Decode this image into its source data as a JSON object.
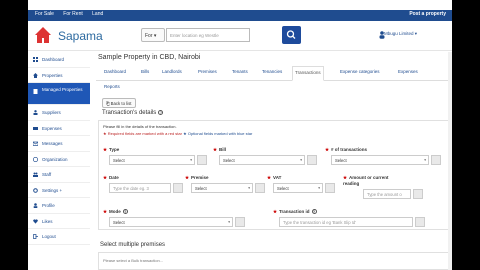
{
  "topnav": {
    "links": [
      "For Sale",
      "For Rent",
      "Land"
    ],
    "post_label": "Post a property"
  },
  "header": {
    "logo_text": "Sapama",
    "for_label": "For",
    "search_placeholder": "Enter location eg Westle",
    "user_label": "Mbugu Limited"
  },
  "sidebar": {
    "items": [
      {
        "label": "Dashboard",
        "icon": "dashboard-icon"
      },
      {
        "label": "Properties",
        "icon": "home-icon"
      },
      {
        "label": "Managed Properties",
        "icon": "building-icon"
      },
      {
        "label": "Suppliers",
        "icon": "user-icon"
      },
      {
        "label": "Expenses",
        "icon": "money-icon"
      },
      {
        "label": "Messages",
        "icon": "envelope-icon"
      },
      {
        "label": "Organization",
        "icon": "org-icon"
      },
      {
        "label": "Staff",
        "icon": "users-icon"
      },
      {
        "label": "Settings +",
        "icon": "gear-icon"
      },
      {
        "label": "Profile",
        "icon": "profile-icon"
      },
      {
        "label": "Likes",
        "icon": "heart-icon"
      },
      {
        "label": "Logout",
        "icon": "logout-icon"
      }
    ]
  },
  "main": {
    "title": "Sample Property in CBD, Nairobi",
    "tabs": [
      "Dashboard",
      "Bills",
      "Landlords",
      "Premises",
      "Tenants",
      "Tenancies",
      "Transactions",
      "Expense categories",
      "Expenses"
    ],
    "reports_label": "Reports",
    "back_label": "Back to list",
    "section_title": "Transaction's details",
    "instruction": "Please fill in the details of the transaction.",
    "required_note": "Required fields are marked with a red star",
    "optional_note": "Optional fields marked with blue star",
    "fields": {
      "type": {
        "label": "Type",
        "value": "Select"
      },
      "bill": {
        "label": "Bill",
        "value": "Select"
      },
      "num_transactions": {
        "label": "# of transactions",
        "value": "Select"
      },
      "date": {
        "label": "Date",
        "placeholder": "Type the date eg. 3"
      },
      "premise": {
        "label": "Premise",
        "value": "Select"
      },
      "vat": {
        "label": "VAT",
        "value": "Select"
      },
      "amount": {
        "label": "Amount or current reading",
        "placeholder": "Type the amount o"
      },
      "mode": {
        "label": "Mode",
        "value": "Select"
      },
      "transaction_id": {
        "label": "Transaction id",
        "placeholder": "Type the transaction id eg 'Bank Slip Id'"
      }
    },
    "multi_title": "Select multiple premises",
    "multi_text": "Please select a Bulk transaction..."
  },
  "colors": {
    "brand": "#1f4c8f",
    "active": "#1f57b6",
    "required": "#cc0000"
  }
}
